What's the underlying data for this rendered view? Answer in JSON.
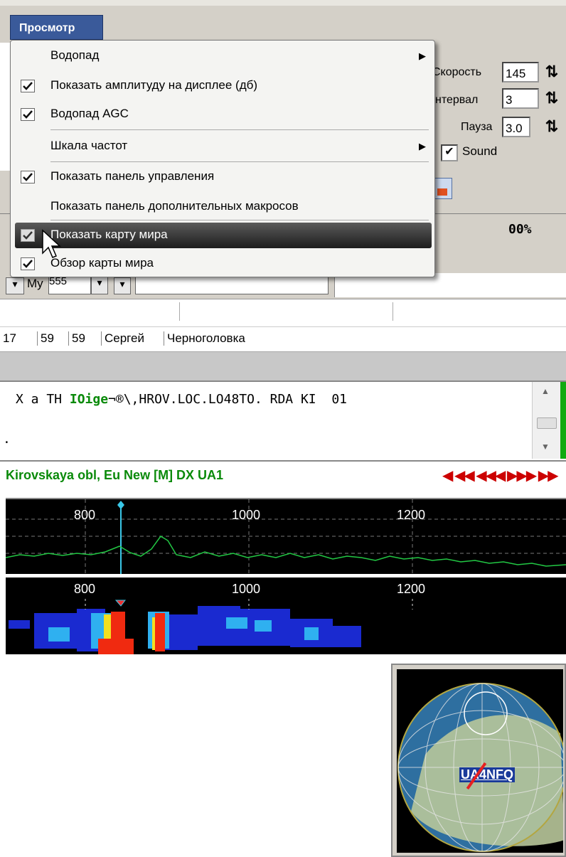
{
  "menubar": {
    "menu_label": "Просмотр"
  },
  "dropdown": {
    "items": [
      {
        "label": "Водопад",
        "checked": false,
        "submenu": true
      },
      {
        "label": "Показать амплитуду на дисплее (дб)",
        "checked": true,
        "submenu": false
      },
      {
        "label": "Водопад AGC",
        "checked": true,
        "submenu": false
      },
      {
        "label": "Шкала частот",
        "checked": false,
        "submenu": true
      },
      {
        "label": "Показать панель управления",
        "checked": true,
        "submenu": false
      },
      {
        "label": "Показать панель дополнительных макросов",
        "checked": false,
        "submenu": false
      },
      {
        "label": "Показать карту мира",
        "checked": true,
        "submenu": false,
        "highlighted": true
      },
      {
        "label": "Обзор карты мира",
        "checked": true,
        "submenu": false
      }
    ]
  },
  "controls": {
    "speed_label": "Скорость",
    "speed_value": "145",
    "interval_label": "нтервал",
    "interval_value": "3",
    "pause_label": "Пауза",
    "pause_value": "3.0",
    "sound_label": "Sound"
  },
  "progress_text": "00%",
  "combo_row": {
    "my_label": "My",
    "combo_value": "555"
  },
  "log_row": [
    "17",
    "59",
    "59",
    "Сергей",
    "Черноголовка"
  ],
  "text_pane": {
    "line_prefix": "X a TH ",
    "line_green": "IOige",
    "line_suffix": "¬®\\,HROV.LOC.LO48TO. RDA KI  01",
    "line2": "."
  },
  "status_line": "Kirovskaya obl, Eu New [M] DX UA1",
  "spectrum_axis": [
    "800",
    "1000",
    "1200"
  ],
  "globe": {
    "callsign": "UA4NFQ"
  },
  "colors": {
    "status_green": "#0a8a0a",
    "menu_title_bg": "#3a5a9a",
    "nav_red": "#cc0000"
  }
}
